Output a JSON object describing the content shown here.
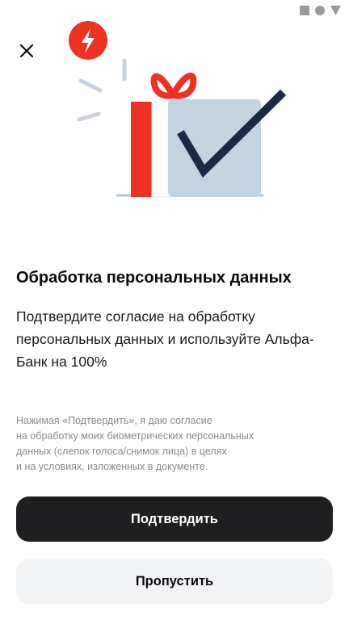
{
  "status_bar": {
    "icons": [
      "square-icon",
      "circle-icon",
      "triangle-icon"
    ]
  },
  "close_icon": "close-icon",
  "illustration": {
    "badge_icon": "lightning-icon",
    "main_icon": "gift-checkmark-icon"
  },
  "content": {
    "title": "Обработка персональных данных",
    "subtitle": "Подтвердите согласие на обработку персональных данных и используйте Альфа-Банк на 100%",
    "legal_lines": [
      "Нажимая «Подтвердить», я даю согласие",
      "на обработку моих биометрических персональных",
      "данных (слепок голоса/снимок лица) в целях",
      "и на условиях, изложенных в документе."
    ]
  },
  "actions": {
    "confirm_label": "Подтвердить",
    "skip_label": "Пропустить"
  },
  "colors": {
    "accent_red": "#ef3124",
    "check_navy": "#1b2a44",
    "card_blue": "#c3d3e0",
    "primary_button": "#1f1f22",
    "secondary_button": "#f2f3f5"
  }
}
